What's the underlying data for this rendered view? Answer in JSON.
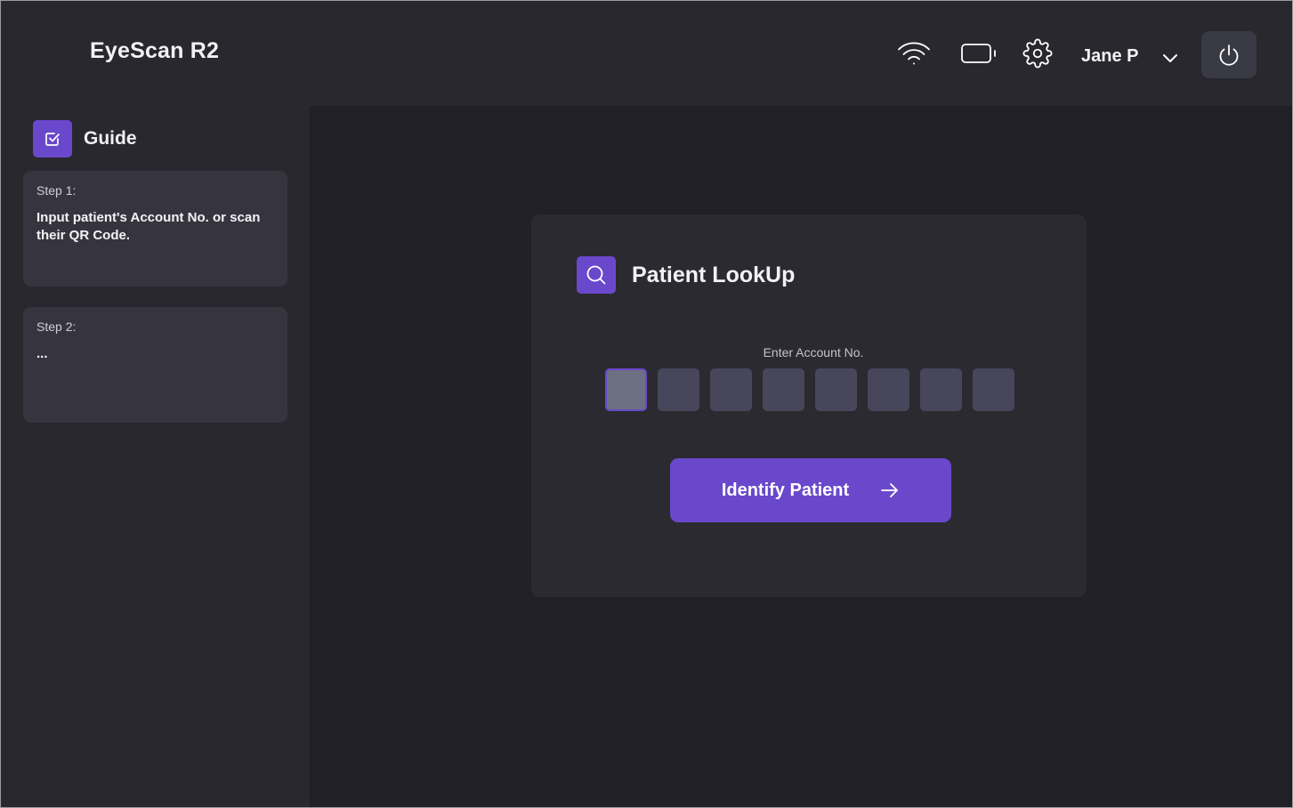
{
  "app": {
    "title": "EyeScan R2"
  },
  "sidebar": {
    "guide_title": "Guide",
    "steps": [
      {
        "label": "Step 1:",
        "text": "Input patient's Account No. or scan their QR Code."
      },
      {
        "label": "Step 2:",
        "text": "..."
      }
    ]
  },
  "topbar": {
    "user_name": "Jane P",
    "icons": [
      "wifi-icon",
      "battery-icon",
      "gear-icon",
      "chevron-down-icon",
      "power-icon"
    ]
  },
  "lookup": {
    "title": "Patient LookUp",
    "field_label": "Enter Account No.",
    "digits": [
      "",
      "",
      "",
      "",
      "",
      "",
      "",
      ""
    ],
    "button_label": "Identify Patient"
  },
  "colors": {
    "accent": "#6a48cc",
    "background": "#202026",
    "panel": "#28282e",
    "card": "#2a2a30"
  }
}
